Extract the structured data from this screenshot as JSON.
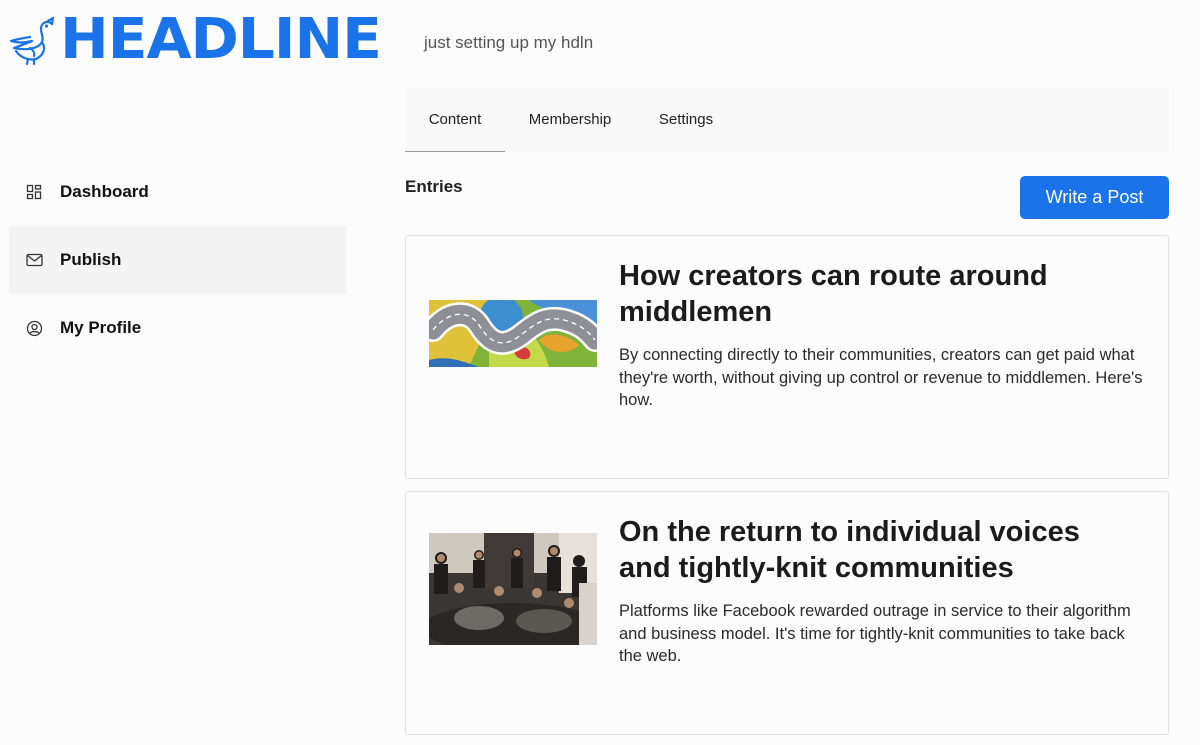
{
  "brand": {
    "name": "HEADLINE",
    "logo_icon": "bird-icon",
    "accent_color": "#1a73e8"
  },
  "tagline": "just setting up my hdln",
  "sidebar": {
    "items": [
      {
        "label": "Dashboard",
        "icon": "dashboard-icon",
        "active": false
      },
      {
        "label": "Publish",
        "icon": "mail-icon",
        "active": true
      },
      {
        "label": "My Profile",
        "icon": "profile-icon",
        "active": false
      }
    ]
  },
  "tabs": [
    {
      "label": "Content",
      "active": true
    },
    {
      "label": "Membership",
      "active": false
    },
    {
      "label": "Settings",
      "active": false
    }
  ],
  "entries": {
    "heading": "Entries",
    "write_button": "Write a Post",
    "posts": [
      {
        "title": "How creators can route around middlemen",
        "description": "By connecting directly to their communities, creators can get paid what they're worth, without giving up control or revenue to middlemen. Here's how."
      },
      {
        "title": "On the return to individual voices and tightly-knit communities",
        "description": "Platforms like Facebook rewarded outrage in service to their algorithm and business model. It's time for tightly-knit communities to take back the web."
      }
    ]
  }
}
